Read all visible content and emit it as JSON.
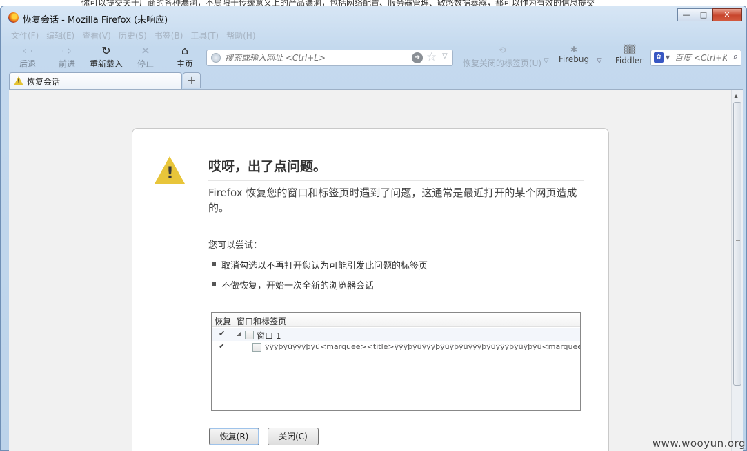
{
  "background_text": "你可以提交关于厂商的各种漏洞，不局限于传统意义上的产品漏洞，包括网络配置、服务器管理、敏感数据暴露，都可以作为有效的信息提交",
  "window": {
    "title": "恢复会话 - Mozilla Firefox (未响应)",
    "minimize": "—",
    "maximize": "□",
    "close": "✕"
  },
  "menu": [
    "文件(F)",
    "编辑(E)",
    "查看(V)",
    "历史(S)",
    "书签(B)",
    "工具(T)",
    "帮助(H)"
  ],
  "toolbar": {
    "back": "后退",
    "forward": "前进",
    "reload": "重新载入",
    "stop": "停止",
    "home": "主页",
    "url_placeholder": "搜索或输入网址 <Ctrl+L>",
    "restore_closed_tabs": "恢复关闭的标签页(U)",
    "firebug": "Firebug",
    "fiddler": "Fiddler",
    "search_placeholder": "百度 <Ctrl+K>"
  },
  "tab": {
    "label": "恢复会话",
    "new_tab": "+"
  },
  "page": {
    "heading": "哎呀，出了点问题。",
    "description": "Firefox 恢复您的窗口和标签页时遇到了问题，这通常是最近打开的某个网页造成的。",
    "try_label": "您可以尝试：",
    "tips": [
      "取消勾选以不再打开您认为可能引发此问题的标签页",
      "不做恢复，开始一次全新的浏览器会话"
    ],
    "tree": {
      "col_restore": "恢复",
      "col_windows_tabs": "窗口和标签页",
      "window_row": "窗口 1",
      "tab_row": "ÿÿÿþÿüÿÿÿþÿü<marquee><title>ÿÿÿþÿüÿÿÿþÿüÿþÿüÿÿÿþÿüÿÿÿþÿüÿþÿü<marquee"
    },
    "restore_button": "恢复(R)",
    "close_button": "关闭(C)"
  },
  "watermark": "www.wooyun.org"
}
